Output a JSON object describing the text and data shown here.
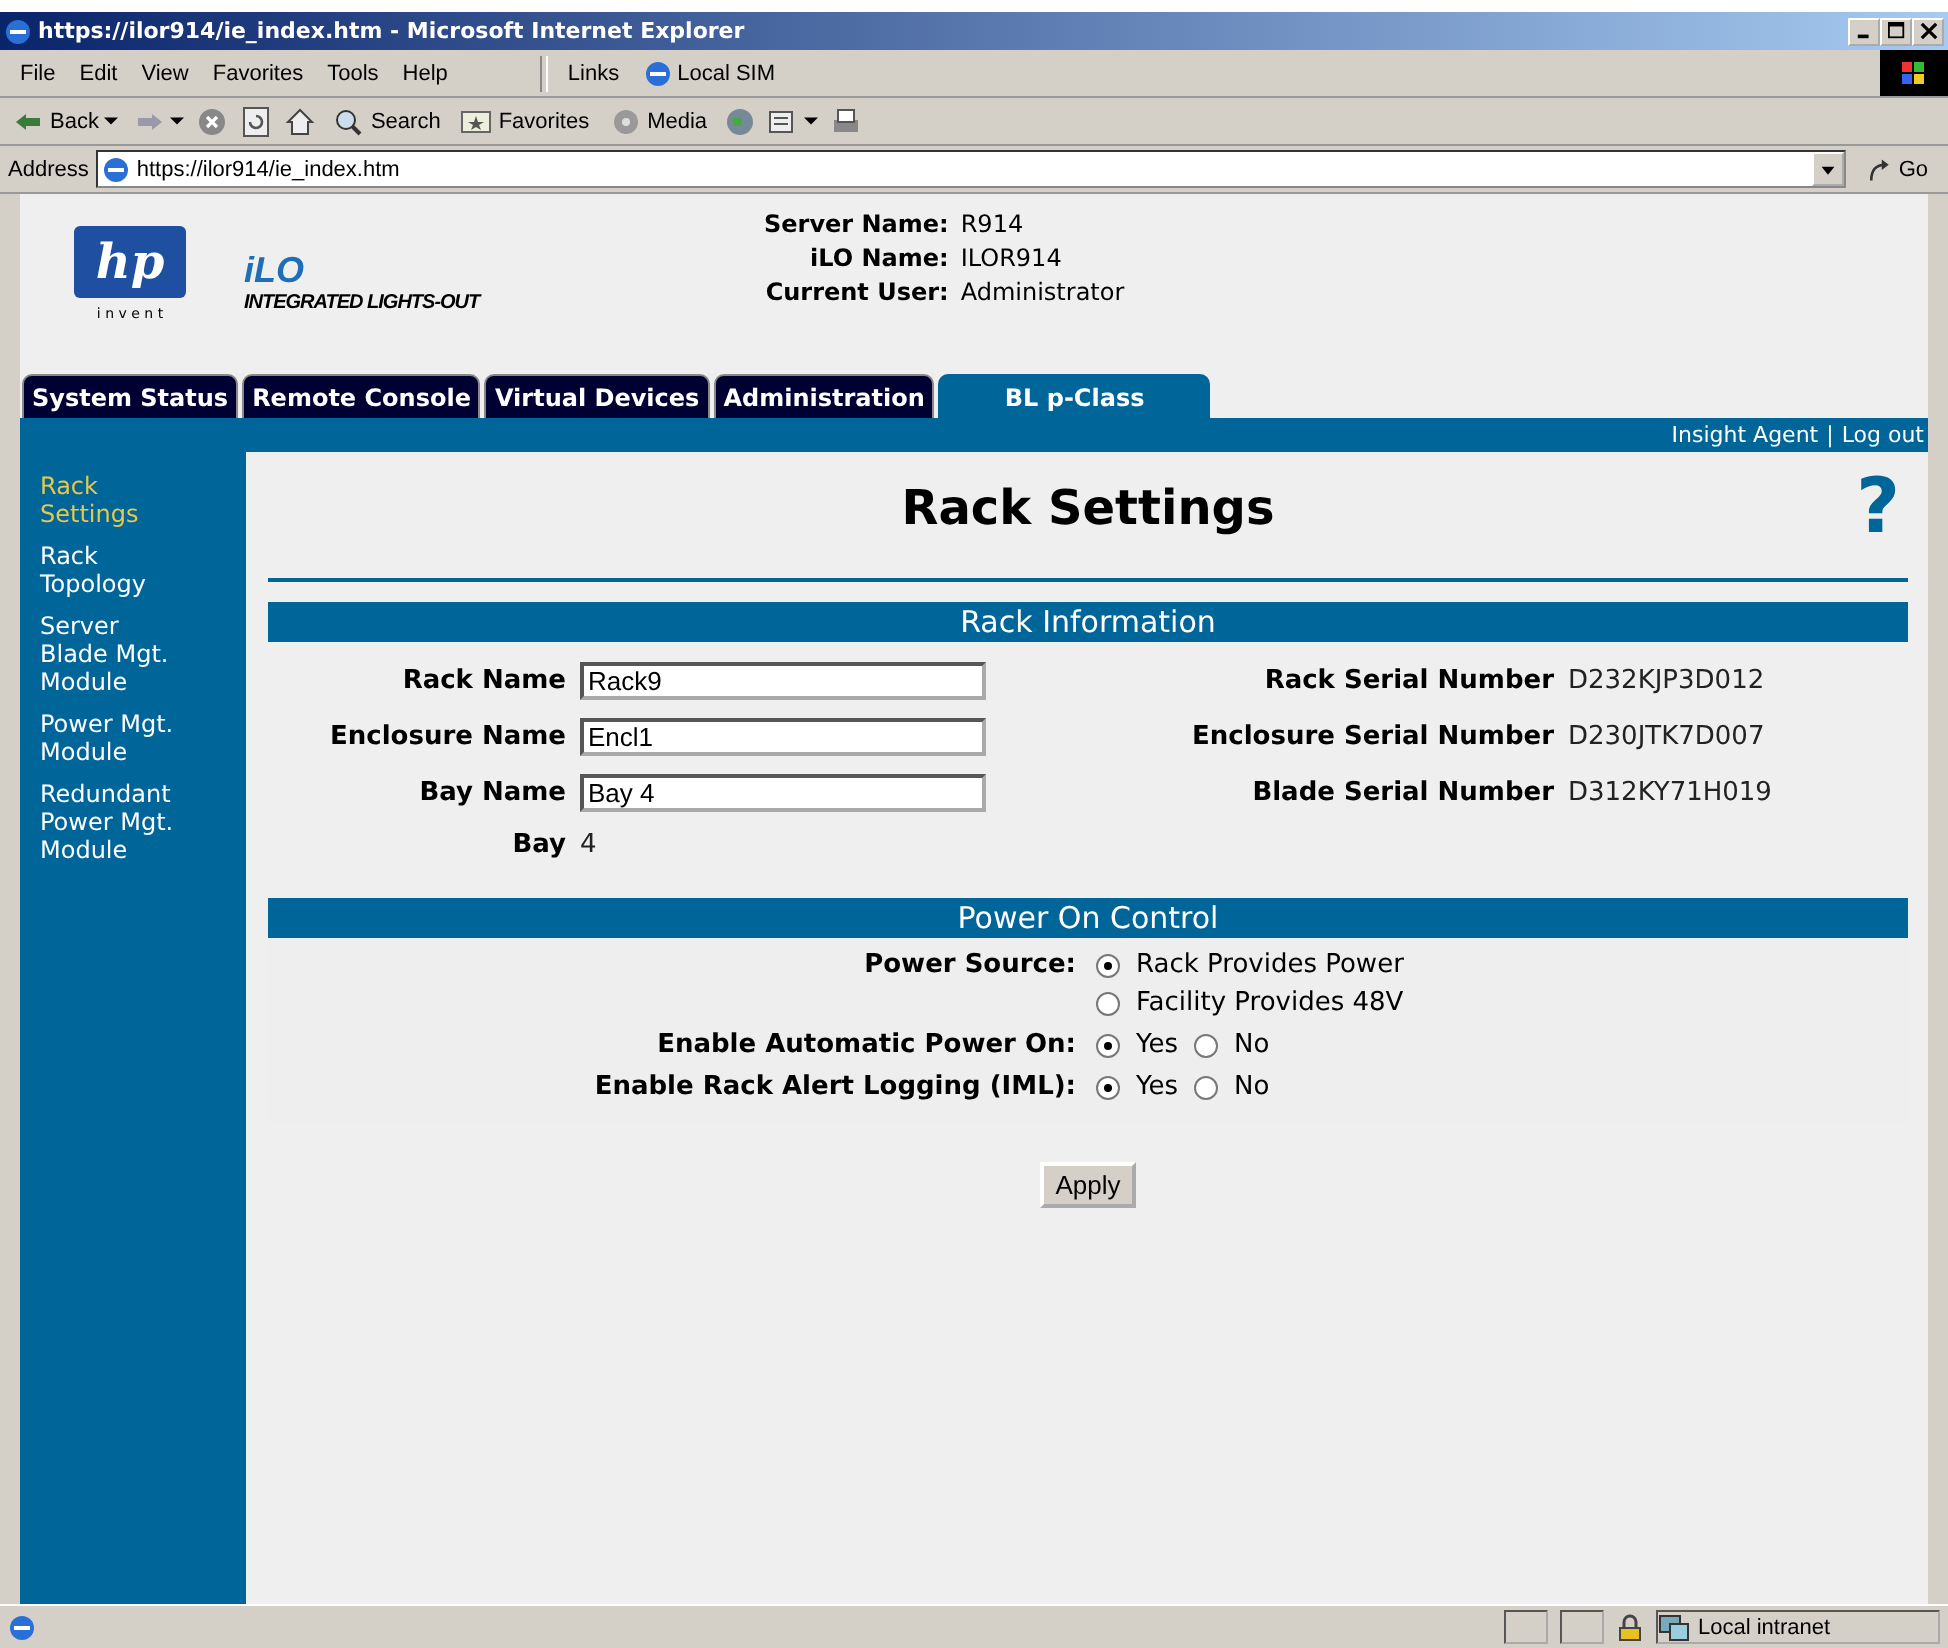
{
  "window": {
    "title": "https://ilor914/ie_index.htm - Microsoft Internet Explorer"
  },
  "menu": [
    "File",
    "Edit",
    "View",
    "Favorites",
    "Tools",
    "Help"
  ],
  "links": {
    "label": "Links",
    "items": [
      "Local SIM"
    ]
  },
  "toolbar": [
    {
      "kind": "back",
      "label": "Back"
    },
    {
      "kind": "forward"
    },
    {
      "kind": "stop"
    },
    {
      "kind": "refresh"
    },
    {
      "kind": "home"
    },
    {
      "kind": "search",
      "label": "Search"
    },
    {
      "kind": "favorites",
      "label": "Favorites"
    },
    {
      "kind": "media",
      "label": "Media"
    },
    {
      "kind": "history"
    },
    {
      "kind": "mail"
    },
    {
      "kind": "print"
    }
  ],
  "address": {
    "label": "Address",
    "value": "https://ilor914/ie_index.htm",
    "go": "Go"
  },
  "logo": {
    "mark": "hp",
    "tagline": "i n v e n t"
  },
  "product": {
    "name": "iLO",
    "subtitle": "INTEGRATED LIGHTS-OUT"
  },
  "info": [
    {
      "label": "Server Name:",
      "value": "R914"
    },
    {
      "label": "iLO Name:",
      "value": "ILOR914"
    },
    {
      "label": "Current User:",
      "value": "Administrator"
    }
  ],
  "tabs": [
    {
      "label": "System Status",
      "selected": false
    },
    {
      "label": "Remote Console",
      "selected": false
    },
    {
      "label": "Virtual Devices",
      "selected": false
    },
    {
      "label": "Administration",
      "selected": false
    },
    {
      "label": "BL p-Class",
      "selected": true
    }
  ],
  "top_links": {
    "items": [
      "Insight Agent",
      "Log out"
    ],
    "separator": "|"
  },
  "sidebar": {
    "items": [
      {
        "label": "Rack Settings",
        "selected": true
      },
      {
        "label": "Rack Topology",
        "selected": false
      },
      {
        "label": "Server Blade Mgt. Module",
        "selected": false
      },
      {
        "label": "Power Mgt. Module",
        "selected": false
      },
      {
        "label": "Redundant Power Mgt. Module",
        "selected": false
      }
    ]
  },
  "page_title": "Rack Settings",
  "help": "?",
  "rack_information": {
    "title": "Rack Information",
    "rows": [
      {
        "label": "Rack Name",
        "value": "Rack9",
        "serial_label": "Rack Serial Number",
        "serial": "D232KJP3D012"
      },
      {
        "label": "Enclosure Name",
        "value": "Encl1",
        "serial_label": "Enclosure Serial Number",
        "serial": "D230JTK7D007"
      },
      {
        "label": "Bay Name",
        "value": "Bay 4",
        "serial_label": "Blade Serial Number",
        "serial": "D312KY71H019"
      }
    ],
    "bay": {
      "label": "Bay",
      "value": "4"
    }
  },
  "power_on_control": {
    "title": "Power On Control",
    "rows": [
      {
        "label": "Power Source:",
        "kind": "stacked",
        "options": [
          {
            "label": "Rack Provides Power",
            "selected": true
          },
          {
            "label": "Facility Provides 48V",
            "selected": false
          }
        ]
      },
      {
        "label": "Enable Automatic Power On:",
        "kind": "inline",
        "options": [
          {
            "label": "Yes",
            "selected": true
          },
          {
            "label": "No",
            "selected": false
          }
        ]
      },
      {
        "label": "Enable Rack Alert Logging (IML):",
        "kind": "inline",
        "options": [
          {
            "label": "Yes",
            "selected": true
          },
          {
            "label": "No",
            "selected": false
          }
        ]
      }
    ]
  },
  "apply": "Apply",
  "status_bar": {
    "zone": "Local intranet"
  }
}
